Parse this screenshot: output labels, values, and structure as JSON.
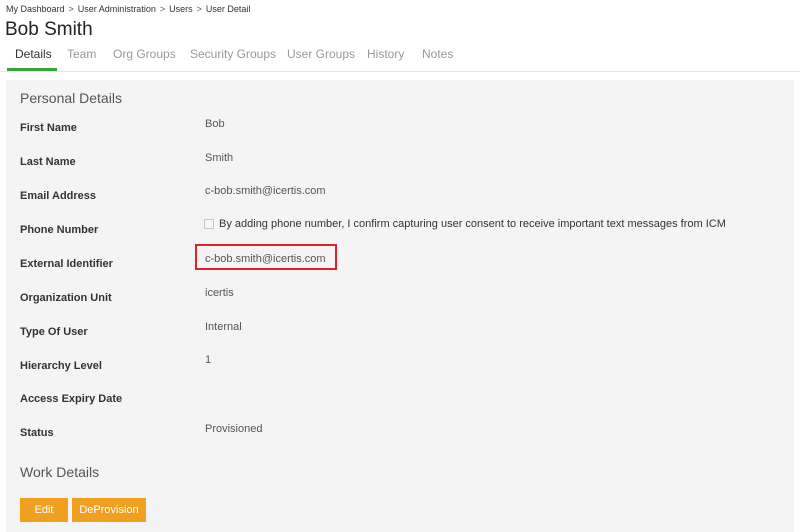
{
  "breadcrumb": {
    "items": [
      "My Dashboard",
      "User Administration",
      "Users",
      "User Detail"
    ],
    "separator": ">"
  },
  "page": {
    "title": "Bob Smith"
  },
  "tabs": [
    {
      "label": "Details",
      "active": true
    },
    {
      "label": "Team"
    },
    {
      "label": "Org Groups"
    },
    {
      "label": "Security Groups"
    },
    {
      "label": "User Groups"
    },
    {
      "label": "History"
    },
    {
      "label": "Notes"
    }
  ],
  "personal_details": {
    "title": "Personal Details",
    "fields": {
      "first_name": {
        "label": "First Name",
        "value": "Bob"
      },
      "last_name": {
        "label": "Last Name",
        "value": "Smith"
      },
      "email": {
        "label": "Email Address",
        "value": "c-bob.smith@icertis.com"
      },
      "phone": {
        "label": "Phone Number",
        "consent_text": "By adding phone number, I confirm capturing user consent to receive important text messages from ICM",
        "consent_checked": false
      },
      "external_id": {
        "label": "External Identifier",
        "value": "c-bob.smith@icertis.com"
      },
      "org_unit": {
        "label": "Organization Unit",
        "value": "icertis"
      },
      "user_type": {
        "label": "Type Of User",
        "value": "Internal"
      },
      "hierarchy": {
        "label": "Hierarchy Level",
        "value": "1"
      },
      "access_expiry": {
        "label": "Access Expiry Date",
        "value": ""
      },
      "status": {
        "label": "Status",
        "value": "Provisioned"
      }
    }
  },
  "work_details": {
    "title": "Work Details"
  },
  "actions": {
    "edit_label": "Edit",
    "deprovision_label": "DeProvision"
  },
  "colors": {
    "accent_green": "#3aa23a",
    "button_orange": "#f0a020",
    "highlight_red": "#e0202a",
    "panel_bg": "#f4f4f4"
  }
}
